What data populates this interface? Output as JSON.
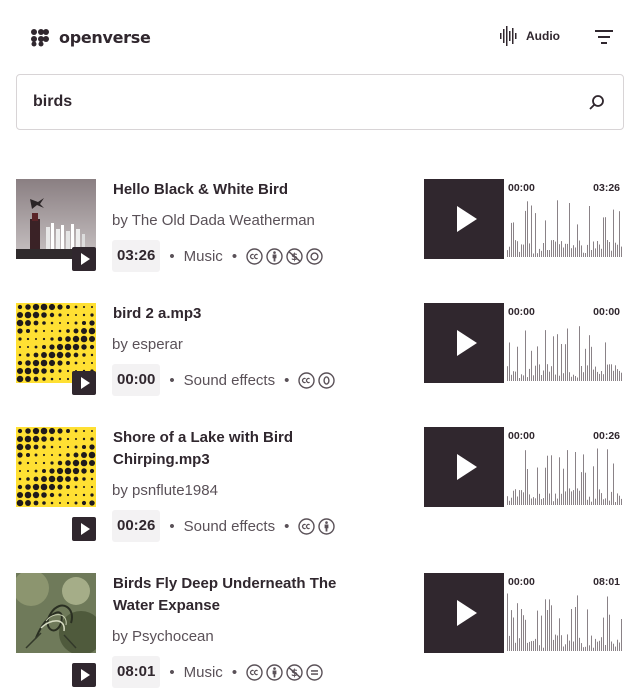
{
  "header": {
    "logo_text": "openverse",
    "media_type": "Audio"
  },
  "search": {
    "query": "birds"
  },
  "results": [
    {
      "title": "Hello Black & White Bird",
      "creator": "by The Old Dada Weatherman",
      "duration": "03:26",
      "category": "Music",
      "licenses": [
        "cc",
        "by",
        "nc",
        "sa"
      ],
      "time_start": "00:00",
      "time_end": "03:26",
      "thumbnail": "dark-tower-bird-photo"
    },
    {
      "title": "bird 2 a.mp3",
      "creator": "by esperar",
      "duration": "00:00",
      "category": "Sound effects",
      "licenses": [
        "cc",
        "zero"
      ],
      "time_start": "00:00",
      "time_end": "00:00",
      "thumbnail": "yellow-dot-pattern"
    },
    {
      "title": "Shore of a Lake with Bird Chirping.mp3",
      "creator": "by psnflute1984",
      "duration": "00:26",
      "category": "Sound effects",
      "licenses": [
        "cc",
        "by"
      ],
      "time_start": "00:00",
      "time_end": "00:26",
      "thumbnail": "yellow-dot-pattern"
    },
    {
      "title": "Birds Fly Deep Underneath The Water Expanse",
      "creator": "by Psychocean",
      "duration": "08:01",
      "category": "Music",
      "licenses": [
        "cc",
        "by",
        "nc",
        "nd"
      ],
      "time_start": "00:00",
      "time_end": "08:01",
      "thumbnail": "green-foliage-photo"
    }
  ],
  "colors": {
    "text": "#30272e",
    "muted": "#5a5158",
    "thumb_yellow": "#ffe033",
    "border": "#d8d4d6"
  }
}
